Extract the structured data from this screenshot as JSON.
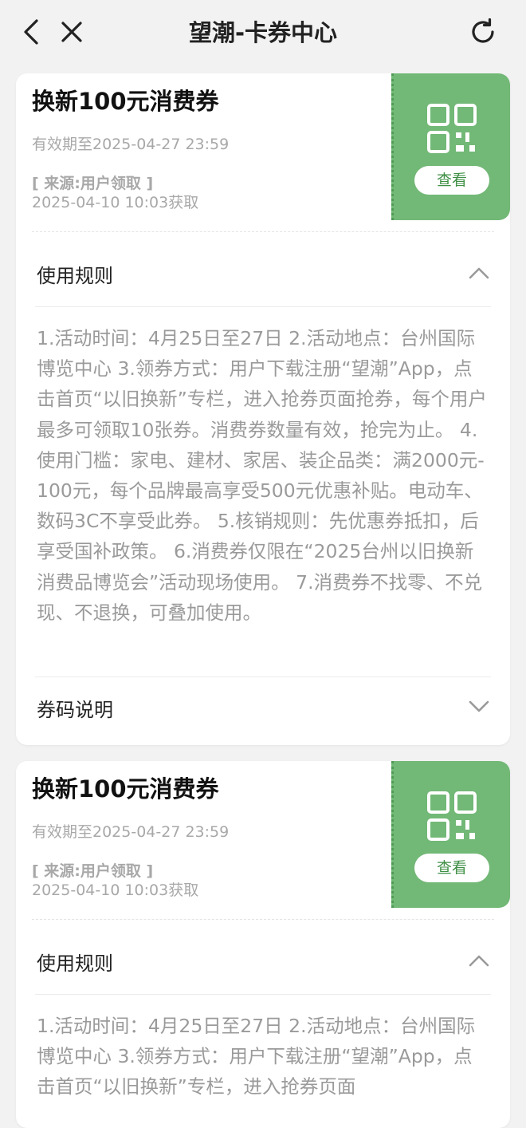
{
  "header": {
    "title": "望潮-卡券中心",
    "back_icon": "chevron-left-icon",
    "close_icon": "close-icon",
    "refresh_icon": "refresh-icon"
  },
  "colors": {
    "stub_green": "#72b876",
    "stub_button_text": "#3f8f45",
    "muted_text": "#a8a8a8"
  },
  "coupons": [
    {
      "title": "换新100元消费券",
      "validity": "有效期至2025-04-27 23:59",
      "source": "[ 来源:用户领取 ]",
      "obtained": "2025-04-10 10:03获取",
      "view_label": "查看",
      "rules_label": "使用规则",
      "rules_expanded": true,
      "rules_text": "1.活动时间：4月25日至27日 2.活动地点：台州国际博览中心 3.领券方式：用户下载注册“望潮”App，点击首页“以旧换新”专栏，进入抢券页面抢券，每个用户最多可领取10张券。消费券数量有效，抢完为止。 4.使用门槛：家电、建材、家居、装企品类：满2000元-100元，每个品牌最高享受500元优惠补贴。电动车、数码3C不享受此券。 5.核销规则：先优惠券抵扣，后享受国补政策。 6.消费券仅限在“2025台州以旧换新消费品博览会”活动现场使用。 7.消费券不找零、不兑现、不退换，可叠加使用。",
      "code_label": "券码说明",
      "code_expanded": false
    },
    {
      "title": "换新100元消费券",
      "validity": "有效期至2025-04-27 23:59",
      "source": "[ 来源:用户领取 ]",
      "obtained": "2025-04-10 10:03获取",
      "view_label": "查看",
      "rules_label": "使用规则",
      "rules_expanded": true,
      "rules_text": "1.活动时间：4月25日至27日 2.活动地点：台州国际博览中心 3.领券方式：用户下载注册“望潮”App，点击首页“以旧换新”专栏，进入抢券页面"
    }
  ]
}
